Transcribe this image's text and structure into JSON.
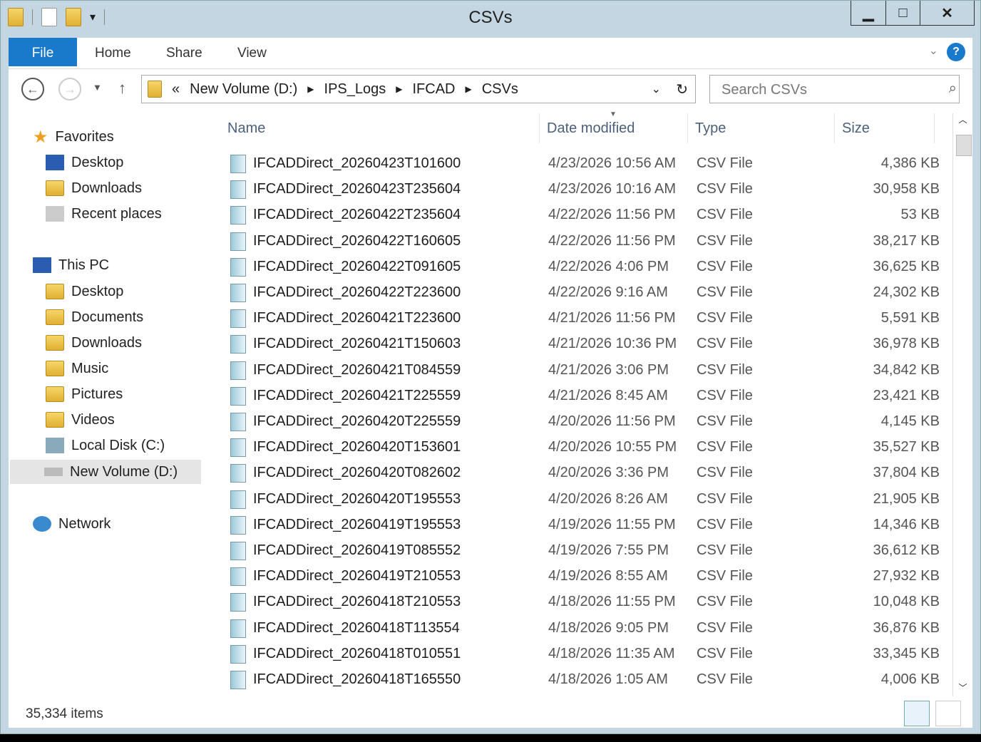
{
  "window": {
    "title": "CSVs"
  },
  "ribbon": {
    "tabs": [
      "File",
      "Home",
      "Share",
      "View"
    ],
    "help": "?"
  },
  "address": {
    "overflow": "«",
    "crumbs": [
      "New Volume (D:)",
      "IPS_Logs",
      "IFCAD",
      "CSVs"
    ]
  },
  "search": {
    "placeholder": "Search CSVs"
  },
  "sidebar": {
    "favorites": "Favorites",
    "fav_items": [
      "Desktop",
      "Downloads",
      "Recent places"
    ],
    "this_pc": "This PC",
    "pc_items": [
      "Desktop",
      "Documents",
      "Downloads",
      "Music",
      "Pictures",
      "Videos",
      "Local Disk (C:)",
      "New Volume (D:)"
    ],
    "network": "Network"
  },
  "columns": [
    "Name",
    "Date modified",
    "Type",
    "Size"
  ],
  "files": [
    [
      "IFCADDirect_20260423T101600",
      "4/23/2026 10:56 AM",
      "CSV File",
      "4,386 KB"
    ],
    [
      "IFCADDirect_20260423T235604",
      "4/23/2026 10:16 AM",
      "CSV File",
      "30,958 KB"
    ],
    [
      "IFCADDirect_20260422T235604",
      "4/22/2026 11:56 PM",
      "CSV File",
      "53 KB"
    ],
    [
      "IFCADDirect_20260422T160605",
      "4/22/2026 11:56 PM",
      "CSV File",
      "38,217 KB"
    ],
    [
      "IFCADDirect_20260422T091605",
      "4/22/2026 4:06 PM",
      "CSV File",
      "36,625 KB"
    ],
    [
      "IFCADDirect_20260422T223600",
      "4/22/2026 9:16 AM",
      "CSV File",
      "24,302 KB"
    ],
    [
      "IFCADDirect_20260421T223600",
      "4/21/2026 11:56 PM",
      "CSV File",
      "5,591 KB"
    ],
    [
      "IFCADDirect_20260421T150603",
      "4/21/2026 10:36 PM",
      "CSV File",
      "36,978 KB"
    ],
    [
      "IFCADDirect_20260421T084559",
      "4/21/2026 3:06 PM",
      "CSV File",
      "34,842 KB"
    ],
    [
      "IFCADDirect_20260421T225559",
      "4/21/2026 8:45 AM",
      "CSV File",
      "23,421 KB"
    ],
    [
      "IFCADDirect_20260420T225559",
      "4/20/2026 11:56 PM",
      "CSV File",
      "4,145 KB"
    ],
    [
      "IFCADDirect_20260420T153601",
      "4/20/2026 10:55 PM",
      "CSV File",
      "35,527 KB"
    ],
    [
      "IFCADDirect_20260420T082602",
      "4/20/2026 3:36 PM",
      "CSV File",
      "37,804 KB"
    ],
    [
      "IFCADDirect_20260420T195553",
      "4/20/2026 8:26 AM",
      "CSV File",
      "21,905 KB"
    ],
    [
      "IFCADDirect_20260419T195553",
      "4/19/2026 11:55 PM",
      "CSV File",
      "14,346 KB"
    ],
    [
      "IFCADDirect_20260419T085552",
      "4/19/2026 7:55 PM",
      "CSV File",
      "36,612 KB"
    ],
    [
      "IFCADDirect_20260419T210553",
      "4/19/2026 8:55 AM",
      "CSV File",
      "27,932 KB"
    ],
    [
      "IFCADDirect_20260418T210553",
      "4/18/2026 11:55 PM",
      "CSV File",
      "10,048 KB"
    ],
    [
      "IFCADDirect_20260418T113554",
      "4/18/2026 9:05 PM",
      "CSV File",
      "36,876 KB"
    ],
    [
      "IFCADDirect_20260418T010551",
      "4/18/2026 11:35 AM",
      "CSV File",
      "33,345 KB"
    ],
    [
      "IFCADDirect_20260418T165550",
      "4/18/2026 1:05 AM",
      "CSV File",
      "4,006 KB"
    ]
  ],
  "status": {
    "items": "35,334 items"
  }
}
